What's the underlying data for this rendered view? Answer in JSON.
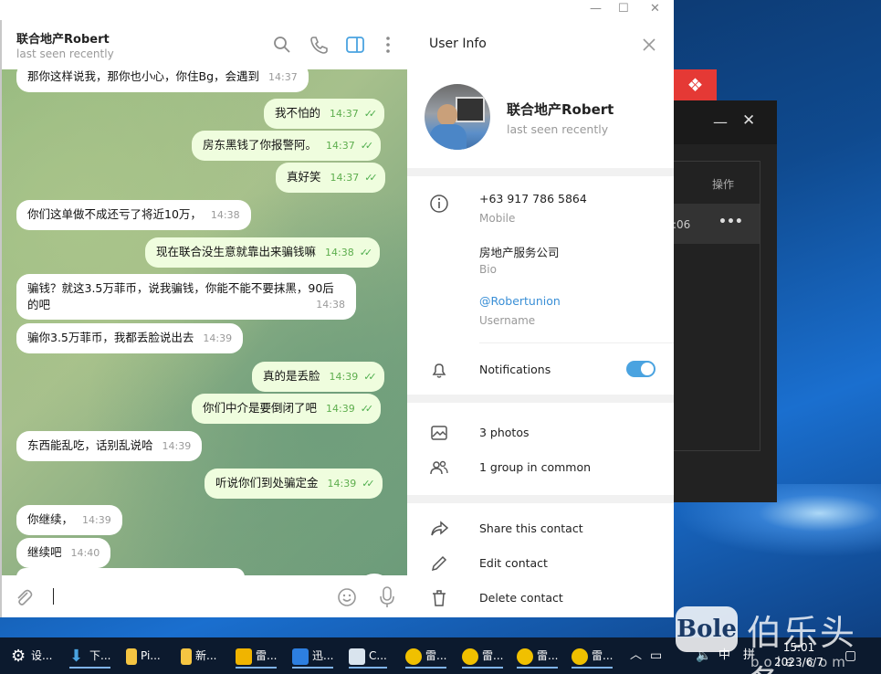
{
  "colors": {
    "accent": "#4aa3e0",
    "outgoing_bubble": "#effdde",
    "incoming_bubble": "#ffffff",
    "check": "#4fae4e"
  },
  "chat": {
    "name": "联合地产Robert",
    "status": "last seen recently",
    "messages": [
      {
        "dir": "in",
        "text": "那你这样说我，那你也小心，你住Bg，会遇到",
        "time": "14:37"
      },
      {
        "dir": "out",
        "text": "我不怕的",
        "time": "14:37"
      },
      {
        "dir": "out",
        "text": "房东黑钱了你报警阿。",
        "time": "14:37"
      },
      {
        "dir": "out",
        "text": "真好笑",
        "time": "14:37"
      },
      {
        "dir": "in",
        "text": "你们这单做不成还亏了将近10万，",
        "time": "14:38"
      },
      {
        "dir": "out",
        "text": "现在联合没生意就靠出来骗钱嘛",
        "time": "14:38"
      },
      {
        "dir": "in",
        "text": "骗钱？就这3.5万菲币，说我骗钱，你能不能不要抹黑，90后的吧",
        "time": "14:38"
      },
      {
        "dir": "in",
        "text": "骗你3.5万菲币，我都丢脸说出去",
        "time": "14:39"
      },
      {
        "dir": "out",
        "text": "真的是丢脸",
        "time": "14:39"
      },
      {
        "dir": "out",
        "text": "你们中介是要倒闭了吧",
        "time": "14:39"
      },
      {
        "dir": "in",
        "text": "东西能乱吃，话别乱说哈",
        "time": "14:39"
      },
      {
        "dir": "out",
        "text": "听说你们到处骗定金",
        "time": "14:39"
      },
      {
        "dir": "in",
        "text": "你继续，",
        "time": "14:39"
      },
      {
        "dir": "in",
        "text": "继续吧",
        "time": "14:40"
      }
    ],
    "unread_count": "1"
  },
  "info": {
    "title": "User Info",
    "name": "联合地产Robert",
    "status": "last seen recently",
    "phone": "+63 917 786 5864",
    "phone_label": "Mobile",
    "bio": "房地产服务公司",
    "bio_label": "Bio",
    "username": "@Robertunion",
    "username_label": "Username",
    "notifications": "Notifications",
    "notifications_on": true,
    "photos": "3 photos",
    "groups": "1 group in common",
    "share": "Share this contact",
    "edit": "Edit contact",
    "delete": "Delete contact"
  },
  "bgapp": {
    "header": "操作",
    "row_time": ":06",
    "row_more": "•••"
  },
  "taskbar": {
    "items": [
      "设...",
      "下...",
      "Pi...",
      "新...",
      "雷...",
      "迅...",
      "C...",
      "雷...",
      "雷...",
      "雷...",
      "雷..."
    ],
    "ime": "中",
    "ime2": "拼",
    "time": "15:01",
    "date": "2023/6/7"
  },
  "watermark": {
    "logo": "Bole",
    "cn": "伯乐头条",
    "url": "bole.com"
  }
}
